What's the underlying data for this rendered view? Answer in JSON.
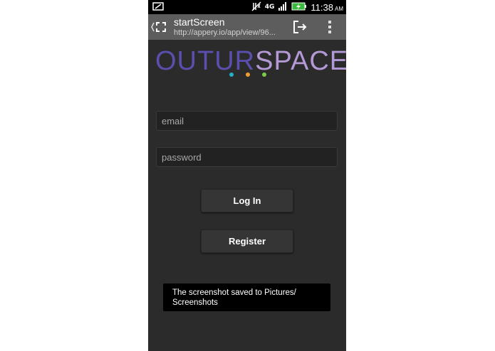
{
  "status_bar": {
    "time": "11:38",
    "ampm": "AM",
    "icons": [
      "screenshot-icon",
      "vibrate-off-icon",
      "lte-4g-icon",
      "signal-icon",
      "battery-charging-icon"
    ],
    "lte_label": "4G"
  },
  "browser": {
    "page_title": "startScreen",
    "url": "http://appery.io/app/view/96..."
  },
  "logo": {
    "part1": "OUTUR",
    "part2": "SPACE",
    "colors": {
      "primary": "#5a4fae",
      "secondary": "#b39ad6"
    },
    "dots": [
      "#1fb3c6",
      "#f0a030",
      "#7ccc4a"
    ]
  },
  "form": {
    "email_placeholder": "email",
    "password_placeholder": "password",
    "login_label": "Log In",
    "register_label": "Register"
  },
  "toast": {
    "line1": "The screenshot saved to Pictures/",
    "line2": "Screenshots"
  }
}
